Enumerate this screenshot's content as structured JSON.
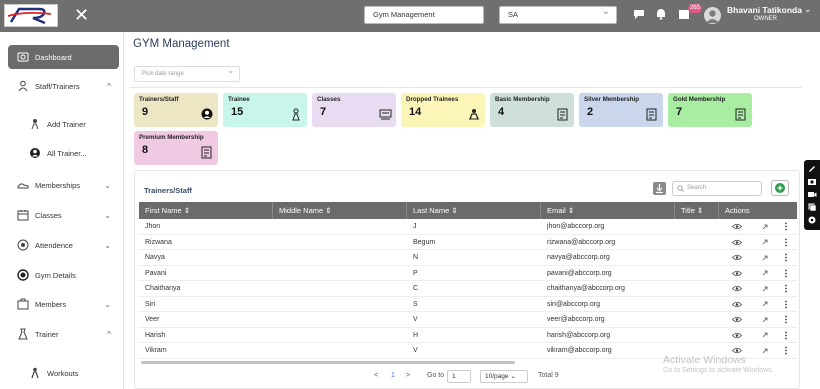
{
  "topbar": {
    "logo_text": "R",
    "gym_select_value": "Gym Management",
    "branch_select_value": "SA",
    "notification_count": "265",
    "user_name": "Bhavani Tatikonda",
    "user_role": "OWNER"
  },
  "sidebar": {
    "items": [
      {
        "label": "Dashboard",
        "icon": "dashboard-icon"
      },
      {
        "label": "Staff/Trainers",
        "icon": "staff-icon"
      },
      {
        "label": "Add Trainer",
        "icon": "add-trainer-icon"
      },
      {
        "label": "All Trainer...",
        "icon": "all-trainers-icon"
      },
      {
        "label": "Memberships",
        "icon": "membership-icon"
      },
      {
        "label": "Classes",
        "icon": "classes-icon"
      },
      {
        "label": "Attendence",
        "icon": "attendance-icon"
      },
      {
        "label": "Gym Details",
        "icon": "gym-details-icon"
      },
      {
        "label": "Members",
        "icon": "members-icon"
      },
      {
        "label": "Trainer",
        "icon": "trainer-icon"
      },
      {
        "label": "Workouts",
        "icon": "workouts-icon"
      }
    ]
  },
  "main": {
    "title": "GYM Management",
    "date_placeholder": "Pick date range"
  },
  "cards": [
    {
      "label": "Trainers/Staff",
      "value": "9",
      "color": "#ece6c4",
      "icon": "staff-avatar-icon"
    },
    {
      "label": "Trainee",
      "value": "15",
      "color": "#c8f6ea",
      "icon": "trainee-icon"
    },
    {
      "label": "Classes",
      "value": "7",
      "color": "#e8dcf2",
      "icon": "classes-board-icon"
    },
    {
      "label": "Dropped Trainees",
      "value": "14",
      "color": "#fbf6b8",
      "icon": "dropped-icon"
    },
    {
      "label": "Basic Membership",
      "value": "4",
      "color": "#cfe0da",
      "icon": "membership-card-icon"
    },
    {
      "label": "Silver Membership",
      "value": "2",
      "color": "#c9d6ec",
      "icon": "membership-card-icon"
    },
    {
      "label": "Gold Membership",
      "value": "7",
      "color": "#a8eda2",
      "icon": "membership-card-icon"
    },
    {
      "label": "Premium Membership",
      "value": "8",
      "color": "#f0c9e2",
      "icon": "membership-card-icon"
    }
  ],
  "table": {
    "title": "Trainers/Staff",
    "search_placeholder": "Search",
    "columns": [
      "First Name",
      "Middle Name",
      "Last Name",
      "Email",
      "Title",
      "Actions"
    ],
    "rows": [
      [
        "Jhon",
        "",
        "J",
        "jhon@abccorp.org",
        ""
      ],
      [
        "Rizwana",
        "",
        "Begum",
        "rizwana@abccorp.org",
        ""
      ],
      [
        "Navya",
        "",
        "N",
        "navya@abccorp.org",
        ""
      ],
      [
        "Pavani",
        "",
        "P",
        "pavani@abccorp.org",
        ""
      ],
      [
        "Chaithanya",
        "",
        "C",
        "chaithanya@abccorp.org",
        ""
      ],
      [
        "Siri",
        "",
        "S",
        "siri@abccorp.org",
        ""
      ],
      [
        "Veer",
        "",
        "V",
        "veer@abccorp.org",
        ""
      ],
      [
        "Harish",
        "",
        "H",
        "harish@abccorp.org",
        ""
      ],
      [
        "Vikram",
        "",
        "V",
        "vikram@abccorp.org",
        ""
      ]
    ]
  },
  "pagination": {
    "prev": "<",
    "page": "1",
    "next": ">",
    "goto_label": "Go to",
    "goto_value": "1",
    "page_size": "10/page",
    "total": "Total 9"
  },
  "watermark": {
    "line1": "Activate Windows",
    "line2": "Go to Settings to activate Windows."
  }
}
